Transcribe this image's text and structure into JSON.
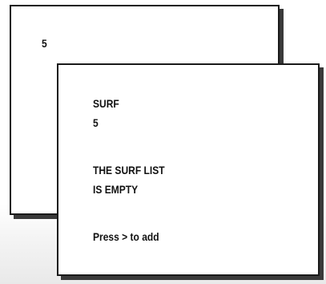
{
  "back_panel": {
    "value": "5"
  },
  "front_panel": {
    "title": "SURF",
    "value": "5",
    "message_line_1": "THE SURF LIST",
    "message_line_2": "IS EMPTY",
    "hint": "Press > to add"
  }
}
